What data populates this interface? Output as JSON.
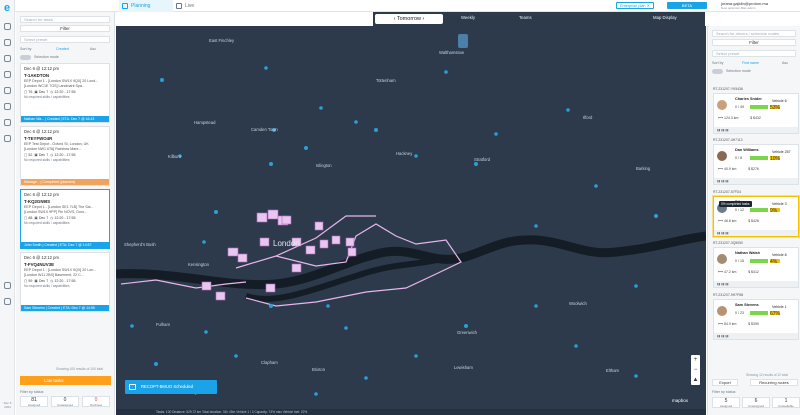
{
  "app": {
    "logo": "e",
    "version": "Dec 6 2024"
  },
  "tabs": [
    {
      "label": "Planning"
    },
    {
      "label": "Live"
    }
  ],
  "header": {
    "enterprise": "Enterprise plan ✕",
    "beta": "BETA",
    "user_name": "jorana.gajidin@protom.ma",
    "user_sub": "New optimizer  Mac admin"
  },
  "map_bar": {
    "date": "‹  Tomorrow  ›",
    "view": "Weekly",
    "teams": "Teams",
    "map_display": "Map Display"
  },
  "left": {
    "search_placeholder": "Search for tasks",
    "filter_label": "Filter",
    "select_placeholder": "Select preset",
    "sort_label": "Sort by",
    "sort_value": "Created",
    "sort_dir": "Asc",
    "selection_mode": "Selection mode",
    "cards": [
      {
        "date": "Dec 6 @ 12:12 pm",
        "id": "T-1AKDTON",
        "addr1": "EEP Depot 1 - [London SW1X 9QX] 20 Lond...",
        "addr2": "[London WC1E 7GS] Landmark Spa...",
        "n": "76",
        "day": "Dec 7",
        "time": "12:20 - 17:55",
        "note": "No required skills / capabilities",
        "foot": "Nathan Wa... | Created | ETA: Dec 7 @ 16:43",
        "color": "#1aa3e8"
      },
      {
        "date": "Dec 6 @ 12:12 pm",
        "id": "T-TEYFWO4R",
        "addr1": "EEP Test Depot - Oxford St, London, UK",
        "addr2": "[London NW1 6TA] Rainbow Mare...",
        "n": "52",
        "day": "Dec 7",
        "time": "12:20 - 17:55",
        "note": "No required skills / capabilities",
        "foot": "Manage... | Completed (planned)",
        "color": "#f0a35e"
      },
      {
        "date": "Dec 6 @ 12:12 pm",
        "id": "T-KQ2GN9IS",
        "addr1": "EEP Depot 1 - [London SE1 7LB] The Sai...",
        "addr2": "[London SW1X 9PP] Pie NOVS, Duro...",
        "n": "88",
        "day": "Dec 7",
        "time": "12:20 - 17:55",
        "note": "No required skills / capabilities",
        "foot": "John Smith | Created | ETA: Dec 7 @ 14:57",
        "color": "#1aa3e8"
      },
      {
        "date": "Dec 6 @ 12:12 pm",
        "id": "T-FVQ4NUV3E",
        "addr1": "EEP Depot 1 - [London SW1X 9QX] 20 Lon...",
        "addr2": "[London W11 2BS] Basement, 22 C...",
        "n": "59",
        "day": "Dec 7",
        "time": "12:20 - 17:55",
        "note": "No required skills / capabilities",
        "foot": "Sam Stevens | Created | ETA: Dec 7 @ 14:55",
        "color": "#1aa3e8"
      }
    ],
    "showing": "Showing 100 results of 100 total",
    "late": "Late tasks",
    "filter_by_status": "Filter by status",
    "statuses": [
      {
        "count": "81",
        "label": "Assigned"
      },
      {
        "count": "0",
        "label": "Unassigned"
      },
      {
        "count": "0",
        "label": "Declined"
      }
    ]
  },
  "right": {
    "search_placeholder": "Search for drivers / schedule routes",
    "filter_label": "Filter",
    "select_placeholder": "Select preset",
    "sort_label": "Sort by",
    "sort_value": "First name",
    "sort_dir": "Asc",
    "selection_mode": "Selection mode",
    "routes": [
      {
        "rid": "RT-231207-YK5436",
        "name": "Charles Snider",
        "vehicle": "Vehicle 6",
        "stat": "0 / 49",
        "pct": "53%",
        "miles": "124.3 km",
        "cost": "$432"
      },
      {
        "rid": "RT-231207-4H7113",
        "name": "Dan Williams",
        "vehicle": "Vehicle 257",
        "stat": "0 / 8",
        "pct": "10%",
        "miles": "40.9 km",
        "cost": "$276"
      },
      {
        "rid": "RT-231207-57FD4",
        "name": "Ethan",
        "vehicle": "Vehicle 3",
        "stat": "0 / 12",
        "pct": "9%",
        "miles": "46.8 km",
        "cost": "$426",
        "tooltip": "0% completed tasks"
      },
      {
        "rid": "RT-231207-3Q5050",
        "name": "Nathan Walsh",
        "vehicle": "Vehicle 8",
        "stat": "0 / 15",
        "pct": "4%",
        "miles": "47.2 km",
        "cost": "$412"
      },
      {
        "rid": "RT-231207-9H7P68",
        "name": "Sam Stevens",
        "vehicle": "Vehicle 1",
        "stat": "0 / 23",
        "pct": "67%",
        "miles": "84.9 km",
        "cost": "$399"
      }
    ],
    "showing": "Showing 12 results of 12 total",
    "export_label": "Export",
    "recurring_label": "Recurring routes",
    "filter_by_status": "Filter by status",
    "statuses": [
      {
        "count": "5",
        "label": "Assigned"
      },
      {
        "count": "6",
        "label": "Unassigned"
      },
      {
        "count": "1",
        "label": "Unavailable"
      }
    ]
  },
  "map": {
    "labels": [
      "East Finchley",
      "Walthamstow",
      "Hampstead",
      "Ilford",
      "Camden Town",
      "Islington",
      "Hackney",
      "Stratford",
      "London",
      "Kensington",
      "Shepherd's Bush",
      "Greenwich",
      "Woolwich",
      "Clapham",
      "Lewisham",
      "Fulham",
      "Eltham",
      "Brixton",
      "Kilburn",
      "Putney",
      "Tottenham",
      "Barking"
    ],
    "sequence": "RECOPT-BMUO   Scheduled",
    "status_line": "Tasks: 100  Distance: 529.72 km  Total duration: 31h 45m  Vehicle 1 / 3  Capacity: 74% max  Vehicle fuel: 22%",
    "mapbox": "mapbox"
  }
}
